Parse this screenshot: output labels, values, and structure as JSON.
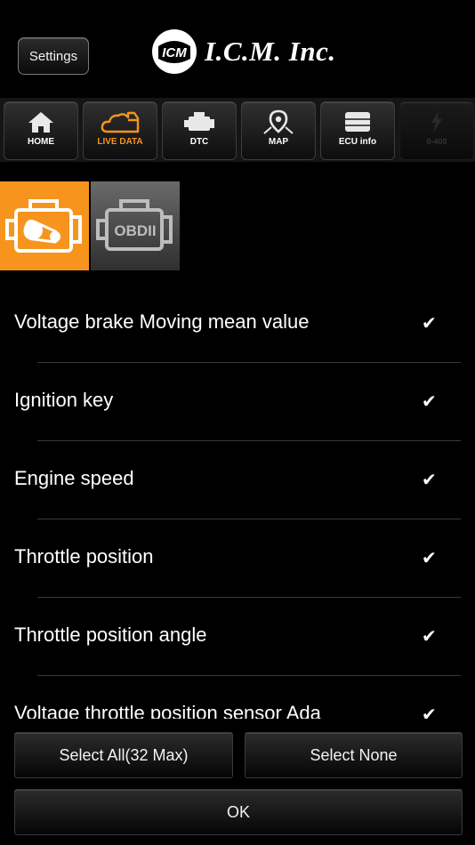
{
  "header": {
    "settings_label": "Settings",
    "brand_mark": "ICM",
    "brand_name": "I.C.M. Inc."
  },
  "nav": {
    "items": [
      {
        "label": "HOME",
        "icon": "home-icon",
        "active": false
      },
      {
        "label": "LIVE DATA",
        "icon": "cloud-live-data-icon",
        "active": true
      },
      {
        "label": "DTC",
        "icon": "engine-icon",
        "active": false
      },
      {
        "label": "MAP",
        "icon": "map-pin-icon",
        "active": false
      },
      {
        "label": "ECU info",
        "icon": "ecu-icon",
        "active": false
      },
      {
        "label": "0-400",
        "icon": "lightning-icon",
        "active": false
      }
    ]
  },
  "subtabs": {
    "engine": {
      "icon": "engine-icon",
      "active": true
    },
    "obd": {
      "label": "OBDII",
      "icon": "obdii-icon",
      "active": false
    }
  },
  "list": {
    "items": [
      {
        "label": "Voltage brake Moving mean value",
        "checked": true
      },
      {
        "label": "Ignition key",
        "checked": true
      },
      {
        "label": "Engine speed",
        "checked": true
      },
      {
        "label": "Throttle position",
        "checked": true
      },
      {
        "label": "Throttle position angle",
        "checked": true
      },
      {
        "label": "Voltage throttle position sensor Ada",
        "checked": true
      }
    ],
    "check_glyph": "✔"
  },
  "buttons": {
    "select_all": "Select All(32 Max)",
    "select_none": "Select None",
    "ok": "OK"
  },
  "colors": {
    "accent": "#f7941d",
    "background": "#000000"
  }
}
